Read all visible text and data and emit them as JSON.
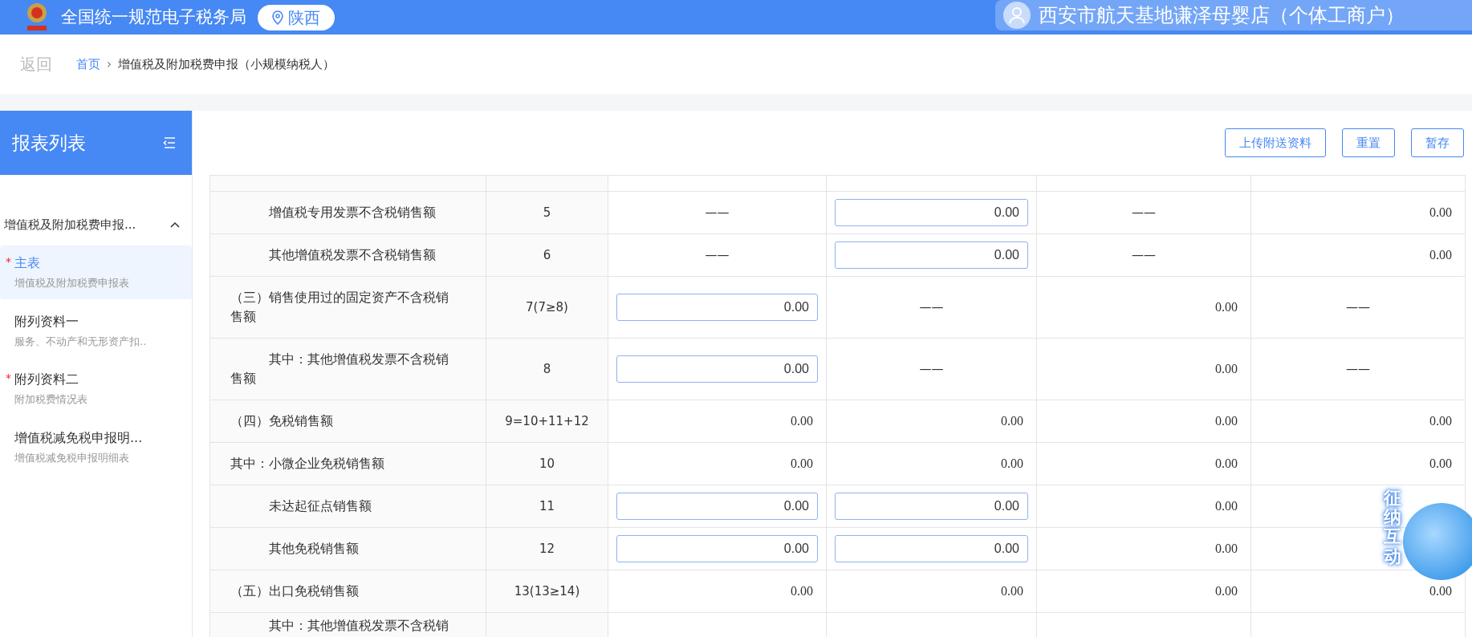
{
  "header": {
    "site_title": "全国统一规范电子税务局",
    "region": "陕西",
    "user_name": "西安市航天基地谦泽母婴店（个体工商户）"
  },
  "breadcrumb": {
    "back": "返回",
    "separator": "›",
    "items": [
      {
        "label": "首页",
        "link": true
      },
      {
        "label": "增值税及附加税费申报（小规模纳税人）",
        "link": false
      }
    ]
  },
  "sidebar": {
    "title": "报表列表",
    "required_mark": "*",
    "group": {
      "label": "增值税及附加税费申报...",
      "expanded": true
    },
    "items": [
      {
        "title": "主表",
        "subtitle": "增值税及附加税费申报表",
        "required": true,
        "selected": true
      },
      {
        "title": "附列资料一",
        "subtitle": "服务、不动产和无形资产扣..",
        "required": false,
        "selected": false
      },
      {
        "title": "附列资料二",
        "subtitle": "附加税费情况表",
        "required": true,
        "selected": false
      },
      {
        "title": "增值税减免税申报明...",
        "subtitle": "增值税减免税申报明细表",
        "required": false,
        "selected": false
      }
    ]
  },
  "toolbar": {
    "buttons": [
      "上传附送资料",
      "重置",
      "暂存"
    ]
  },
  "table": {
    "rows": [
      {
        "kind": "sub",
        "label": "增值税专用发票不含税销售额",
        "line": "5",
        "cells": [
          {
            "kind": "dash",
            "text": "——"
          },
          {
            "kind": "input",
            "text": "0.00"
          },
          {
            "kind": "dash",
            "text": "——"
          },
          {
            "kind": "value",
            "text": "0.00"
          }
        ]
      },
      {
        "kind": "sub",
        "label": "其他增值税发票不含税销售额",
        "line": "6",
        "cells": [
          {
            "kind": "dash",
            "text": "——"
          },
          {
            "kind": "input",
            "text": "0.00"
          },
          {
            "kind": "dash",
            "text": "——"
          },
          {
            "kind": "value",
            "text": "0.00"
          }
        ]
      },
      {
        "kind": "top",
        "label": "（三）销售使用过的固定资产不含税销售额",
        "line": "7(7≥8)",
        "cells": [
          {
            "kind": "input",
            "text": "0.00"
          },
          {
            "kind": "dash",
            "text": "——"
          },
          {
            "kind": "value",
            "text": "0.00"
          },
          {
            "kind": "dash",
            "text": "——"
          }
        ]
      },
      {
        "kind": "sub",
        "label": "其中：其他增值税发票不含税销售额",
        "line": "8",
        "cells": [
          {
            "kind": "input",
            "text": "0.00"
          },
          {
            "kind": "dash",
            "text": "——"
          },
          {
            "kind": "value",
            "text": "0.00"
          },
          {
            "kind": "dash",
            "text": "——"
          }
        ]
      },
      {
        "kind": "top",
        "label": "（四）免税销售额",
        "line": "9=10+11+12",
        "cells": [
          {
            "kind": "value",
            "text": "0.00"
          },
          {
            "kind": "value",
            "text": "0.00"
          },
          {
            "kind": "value",
            "text": "0.00"
          },
          {
            "kind": "value",
            "text": "0.00"
          }
        ]
      },
      {
        "kind": "top",
        "label": "其中：小微企业免税销售额",
        "line": "10",
        "cells": [
          {
            "kind": "value",
            "text": "0.00"
          },
          {
            "kind": "value",
            "text": "0.00"
          },
          {
            "kind": "value",
            "text": "0.00"
          },
          {
            "kind": "value",
            "text": "0.00"
          }
        ]
      },
      {
        "kind": "sub",
        "label": "未达起征点销售额",
        "line": "11",
        "cells": [
          {
            "kind": "input",
            "text": "0.00"
          },
          {
            "kind": "input",
            "text": "0.00"
          },
          {
            "kind": "value",
            "text": "0.00"
          },
          {
            "kind": "hidden"
          }
        ]
      },
      {
        "kind": "sub",
        "label": "其他免税销售额",
        "line": "12",
        "cells": [
          {
            "kind": "input",
            "text": "0.00"
          },
          {
            "kind": "input",
            "text": "0.00"
          },
          {
            "kind": "value",
            "text": "0.00"
          },
          {
            "kind": "hidden"
          }
        ]
      },
      {
        "kind": "top",
        "label": "（五）出口免税销售额",
        "line": "13(13≥14)",
        "cells": [
          {
            "kind": "value",
            "text": "0.00"
          },
          {
            "kind": "value",
            "text": "0.00"
          },
          {
            "kind": "value",
            "text": "0.00"
          },
          {
            "kind": "value",
            "text": "0.00"
          }
        ]
      },
      {
        "kind": "sub",
        "label": "其中：其他增值税发票不含税销",
        "cells": [
          {
            "kind": "hidden"
          },
          {
            "kind": "hidden"
          },
          {
            "kind": "hidden"
          },
          {
            "kind": "hidden"
          }
        ]
      }
    ]
  },
  "assistant": {
    "label": "征纳互动"
  }
}
